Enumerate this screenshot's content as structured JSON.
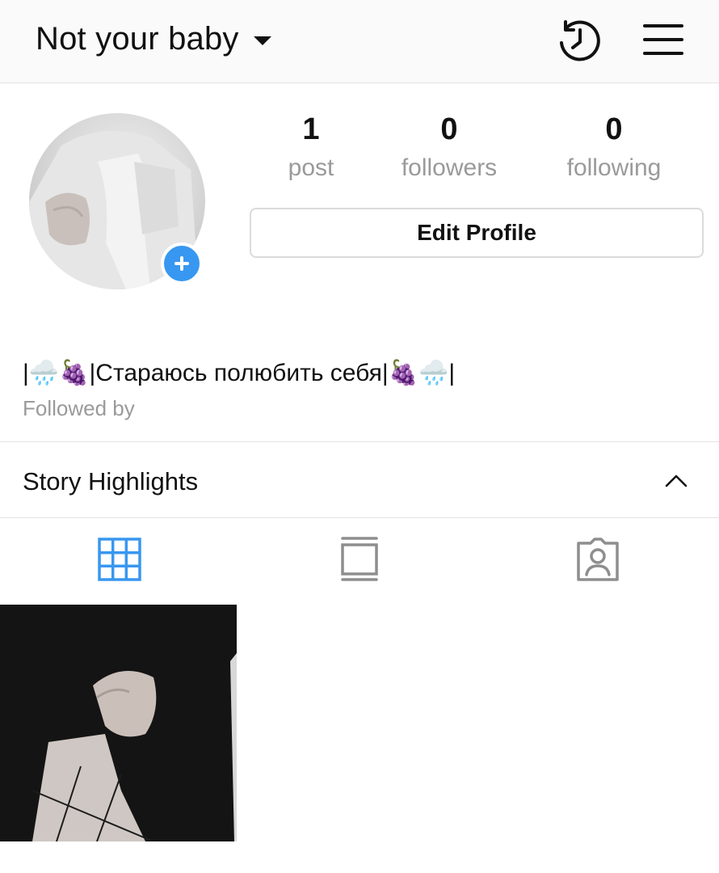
{
  "header": {
    "username": "Not your baby",
    "icons": [
      "history-icon",
      "menu-icon"
    ]
  },
  "profile": {
    "stats": [
      {
        "value": "1",
        "label": "post"
      },
      {
        "value": "0",
        "label": "followers"
      },
      {
        "value": "0",
        "label": "following"
      }
    ],
    "edit_label": "Edit Profile",
    "bio": "|🌧️🍇|Стараюсь полюбить себя|🍇🌧️|",
    "followed_by": "Followed by"
  },
  "highlights": {
    "title": "Story Highlights"
  },
  "tabs": [
    {
      "name": "grid-view",
      "icon": "grid-icon",
      "active": true
    },
    {
      "name": "feed-view",
      "icon": "feed-icon",
      "active": false
    },
    {
      "name": "tagged",
      "icon": "tagged-icon",
      "active": false
    }
  ],
  "colors": {
    "accent": "#3897f0",
    "inactive_icon": "#8e8e8e",
    "muted_text": "#9a9a9a",
    "divider": "#e3e3e3"
  }
}
